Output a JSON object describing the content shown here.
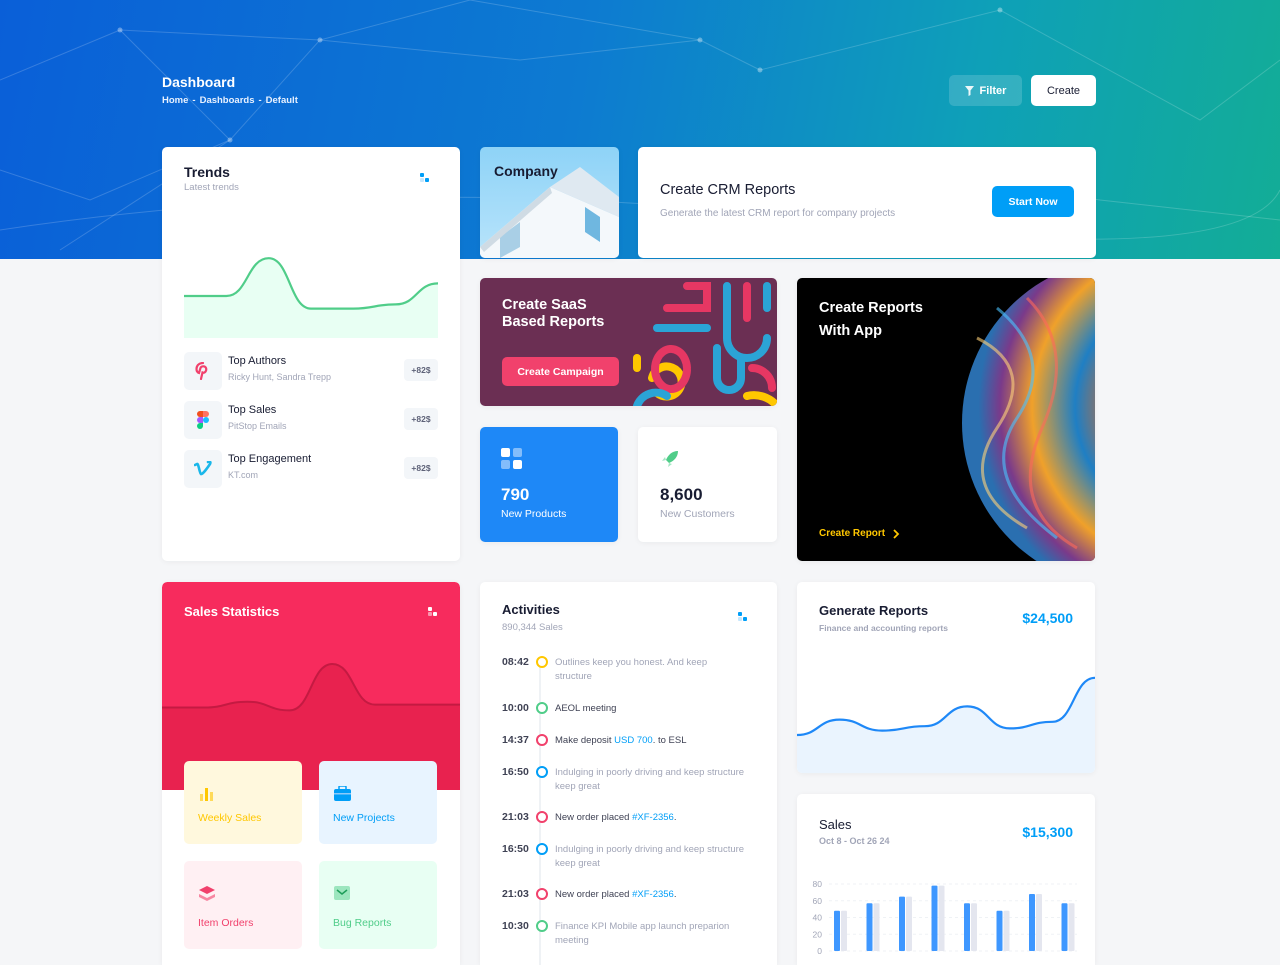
{
  "header": {
    "title": "Dashboard",
    "breadcrumb": [
      "Home",
      "-",
      "Dashboards",
      "-",
      "Default"
    ],
    "filter_label": "Filter",
    "create_label": "Create"
  },
  "trends": {
    "title": "Trends",
    "subtitle": "Latest trends",
    "items": [
      {
        "title": "Top Authors",
        "sub": "Ricky Hunt, Sandra Trepp",
        "badge": "+82$",
        "icon": "pinterest-icon"
      },
      {
        "title": "Top Sales",
        "sub": "PitStop Emails",
        "badge": "+82$",
        "icon": "figma-icon"
      },
      {
        "title": "Top Engagement",
        "sub": "KT.com",
        "badge": "+82$",
        "icon": "vimeo-icon"
      }
    ]
  },
  "company": {
    "title": "Company"
  },
  "crm": {
    "title": "Create CRM Reports",
    "subtitle": "Generate the latest CRM report for company projects",
    "button": "Start Now"
  },
  "saas": {
    "title_line1": "Create SaaS",
    "title_line2": "Based Reports",
    "button": "Create Campaign"
  },
  "products": {
    "value": "790",
    "label": "New Products"
  },
  "customers": {
    "value": "8,600",
    "label": "New Customers"
  },
  "app_reports": {
    "title_line1": "Create Reports",
    "title_line2": "With App",
    "link": "Create Report"
  },
  "sales_stats": {
    "title": "Sales Statistics",
    "tiles": [
      {
        "label": "Weekly Sales",
        "icon": "bar-chart-icon",
        "color": "#ffc700"
      },
      {
        "label": "New Projects",
        "icon": "briefcase-icon",
        "color": "#009ef7"
      },
      {
        "label": "Item Orders",
        "icon": "layers-icon",
        "color": "#f1416c"
      },
      {
        "label": "Bug Reports",
        "icon": "mail-icon",
        "color": "#50cd89"
      }
    ]
  },
  "activities": {
    "title": "Activities",
    "subtitle": "890,344 Sales",
    "rows": [
      {
        "time": "08:42",
        "color": "#ffc700",
        "text": "Outlines keep you honest. And keep structure",
        "muted": true
      },
      {
        "time": "10:00",
        "color": "#50cd89",
        "text": "AEOL meeting",
        "muted": false
      },
      {
        "time": "14:37",
        "color": "#f1416c",
        "text": "Make deposit ",
        "link": "USD 700",
        "after": ". to ESL",
        "muted": false
      },
      {
        "time": "16:50",
        "color": "#009ef7",
        "text": "Indulging in poorly driving and keep structure keep great",
        "muted": true
      },
      {
        "time": "21:03",
        "color": "#f1416c",
        "text": "New order placed ",
        "link": "#XF-2356",
        "after": ".",
        "muted": false
      },
      {
        "time": "16:50",
        "color": "#009ef7",
        "text": "Indulging in poorly driving and keep structure keep great",
        "muted": true
      },
      {
        "time": "21:03",
        "color": "#f1416c",
        "text": "New order placed ",
        "link": "#XF-2356",
        "after": ".",
        "muted": false
      },
      {
        "time": "10:30",
        "color": "#50cd89",
        "text": "Finance KPI Mobile app launch preparion meeting",
        "muted": true
      }
    ]
  },
  "generate": {
    "title": "Generate Reports",
    "subtitle": "Finance and accounting reports",
    "amount": "$24,500"
  },
  "sales": {
    "title": "Sales",
    "subtitle": "Oct 8 - Oct 26 24",
    "amount": "$15,300",
    "y_ticks": [
      "80",
      "60",
      "40",
      "20",
      "0"
    ]
  },
  "colors": {
    "primary": "#009ef7",
    "danger": "#f1416c",
    "success": "#50cd89",
    "warning": "#ffc700",
    "saas_bg": "#6b2f53",
    "products_bg": "#1e88f7"
  },
  "chart_data": [
    {
      "type": "area",
      "title": "Trends",
      "x": [
        0,
        1,
        2,
        3,
        4,
        5,
        6
      ],
      "values": [
        20,
        20,
        38,
        14,
        14,
        16,
        26
      ],
      "ylim": [
        0,
        50
      ]
    },
    {
      "type": "area",
      "title": "Generate Reports",
      "values": [
        30,
        44,
        34,
        38,
        56,
        36,
        42,
        82
      ],
      "ylim": [
        0,
        100
      ]
    },
    {
      "type": "bar",
      "title": "Sales",
      "ylim": [
        0,
        80
      ],
      "series": [
        {
          "values": [
            48,
            57,
            65,
            78,
            57,
            48,
            68,
            57
          ]
        },
        {
          "values": [
            48,
            57,
            65,
            78,
            57,
            48,
            68,
            57
          ]
        }
      ]
    }
  ]
}
